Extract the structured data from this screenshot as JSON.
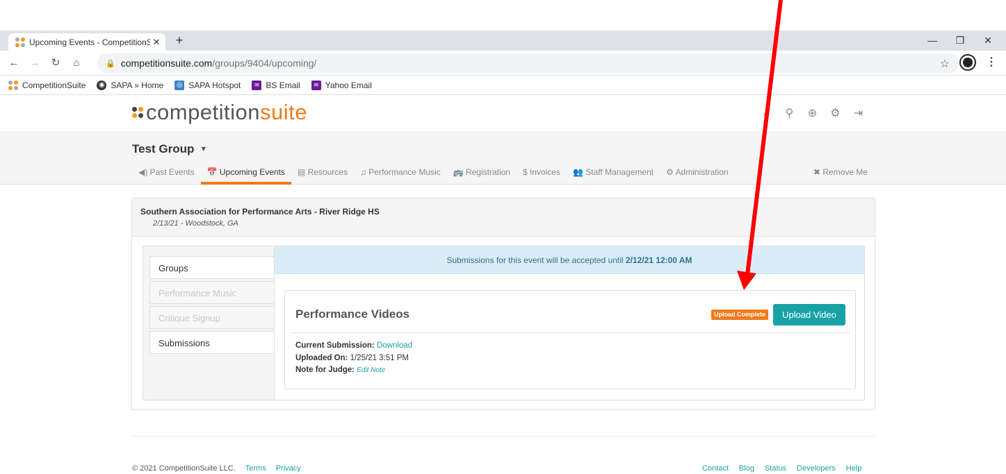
{
  "browser": {
    "tab_title": "Upcoming Events - CompetitionSuite",
    "new_tab": "+",
    "tab_close": "✕",
    "minimize": "—",
    "restore": "❐",
    "close": "✕",
    "url_host": "competitionsuite.com",
    "url_path": "/groups/9404/upcoming/",
    "bookmarks": [
      {
        "label": "CompetitionSuite",
        "icon": "competitionsuite-icon"
      },
      {
        "label": "SAPA » Home",
        "icon": "globe-icon"
      },
      {
        "label": "SAPA Hotspot",
        "icon": "hotspot-icon"
      },
      {
        "label": "BS Email",
        "icon": "mail-icon"
      },
      {
        "label": "Yahoo Email",
        "icon": "mail-icon"
      }
    ]
  },
  "site": {
    "logo_main": "competition",
    "logo_accent": "suite",
    "group_title": "Test Group",
    "nav": [
      {
        "label": "◀) Past Events"
      },
      {
        "label": "📅 Upcoming Events",
        "active": true
      },
      {
        "label": "▤ Resources"
      },
      {
        "label": "♫ Performance Music"
      },
      {
        "label": "🚌 Registration"
      },
      {
        "label": "$ Invoices"
      },
      {
        "label": "👥 Staff Management"
      },
      {
        "label": "⚙ Administration"
      }
    ],
    "remove_me": "✖ Remove Me"
  },
  "event": {
    "name": "Southern Association for Performance Arts - River Ridge HS",
    "date_location": "2/13/21 - Woodstock, GA",
    "side_menu": [
      {
        "label": "Groups",
        "enabled": true
      },
      {
        "label": "Performance Music",
        "enabled": false
      },
      {
        "label": "Critique Signup",
        "enabled": false
      },
      {
        "label": "Submissions",
        "enabled": true
      }
    ],
    "notice_prefix": "Submissions for this event will be accepted until ",
    "notice_deadline": "2/12/21 12:00 AM",
    "videos_title": "Performance Videos",
    "status_badge": "Upload Complete",
    "upload_button": "Upload Video",
    "current_submission_label": "Current Submission:",
    "current_submission_link": "Download",
    "uploaded_on_label": "Uploaded On:",
    "uploaded_on_value": "1/25/21 3:51 PM",
    "note_label": "Note for Judge:",
    "note_link": "Edit Note"
  },
  "footer": {
    "copyright": "© 2021 CompetitionSuite LLC.",
    "terms": "Terms",
    "privacy": "Privacy",
    "right_links": [
      "Contact",
      "Blog",
      "Status",
      "Developers",
      "Help"
    ]
  },
  "colors": {
    "accent_orange": "#f07a1a",
    "teal": "#18a2a6",
    "annotation_arrow": "#ff0000"
  }
}
